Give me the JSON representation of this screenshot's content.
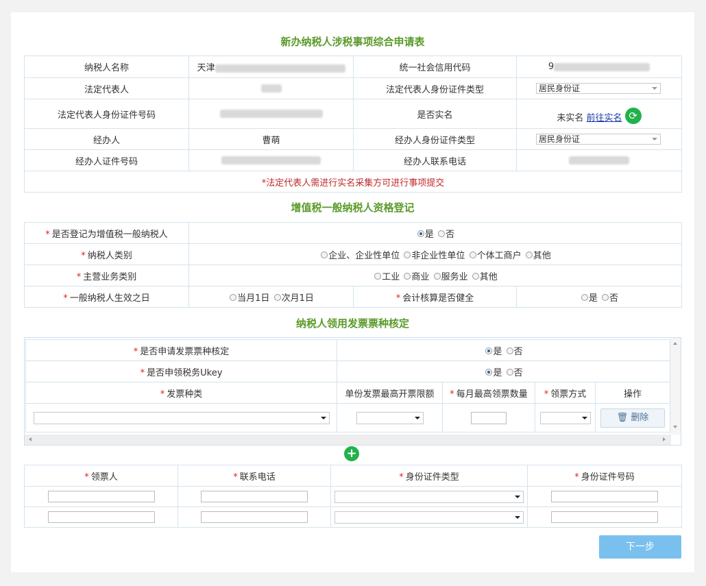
{
  "titles": {
    "main": "新办纳税人涉税事项综合申请表",
    "vat": "增值税一般纳税人资格登记",
    "invoice": "纳税人领用发票票种核定"
  },
  "taxpayer": {
    "name_label": "纳税人名称",
    "name_value": "天津",
    "credit_code_label": "统一社会信用代码",
    "credit_code_value": "9",
    "legal_rep_label": "法定代表人",
    "legal_id_type_label": "法定代表人身份证件类型",
    "legal_id_type_value": "居民身份证",
    "legal_id_no_label": "法定代表人身份证件号码",
    "realname_label": "是否实名",
    "realname_status": "未实名",
    "realname_link": "前往实名",
    "agent_label": "经办人",
    "agent_value": "曹萌",
    "agent_id_type_label": "经办人身份证件类型",
    "agent_id_type_value": "居民身份证",
    "agent_id_no_label": "经办人证件号码",
    "agent_phone_label": "经办人联系电话",
    "notice": "*法定代表人需进行实名采集方可进行事项提交"
  },
  "vat": {
    "register_label": "是否登记为增值税一般纳税人",
    "yes": "是",
    "no": "否",
    "type_label": "纳税人类别",
    "type_options": [
      "企业、企业性单位",
      "非企业性单位",
      "个体工商户",
      "其他"
    ],
    "business_label": "主营业务类别",
    "business_options": [
      "工业",
      "商业",
      "服务业",
      "其他"
    ],
    "effective_label": "一般纳税人生效之日",
    "effective_options": [
      "当月1日",
      "次月1日"
    ],
    "accounting_label": "会计核算是否健全"
  },
  "invoice": {
    "apply_label": "是否申请发票票种核定",
    "ukey_label": "是否申领税务Ukey",
    "headers": [
      "发票种类",
      "单份发票最高开票限额",
      "每月最高领票数量",
      "领票方式",
      "操作"
    ],
    "delete_label": "删除"
  },
  "receiver": {
    "headers": [
      "领票人",
      "联系电话",
      "身份证件类型",
      "身份证件号码"
    ]
  },
  "buttons": {
    "next": "下一步"
  }
}
